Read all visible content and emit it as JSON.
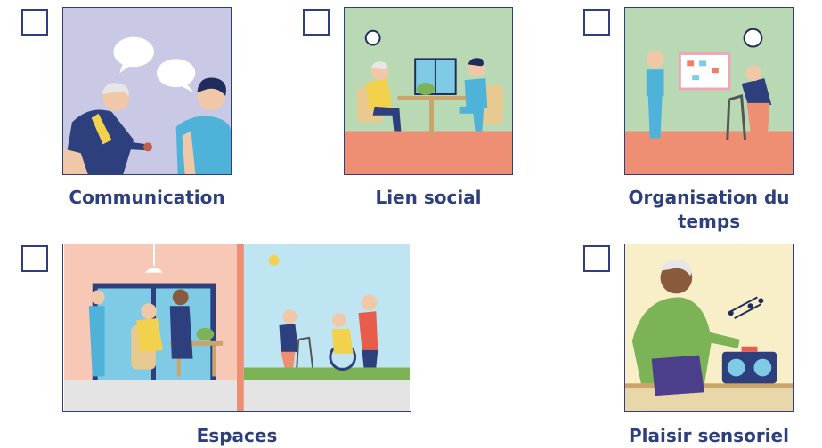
{
  "cards": [
    {
      "label": "Communication"
    },
    {
      "label": "Lien social"
    },
    {
      "label": "Organisation du temps"
    },
    {
      "label": "Espaces"
    },
    {
      "label": "Plaisir sensoriel"
    }
  ],
  "colors": {
    "accent": "#2d3f7c"
  }
}
